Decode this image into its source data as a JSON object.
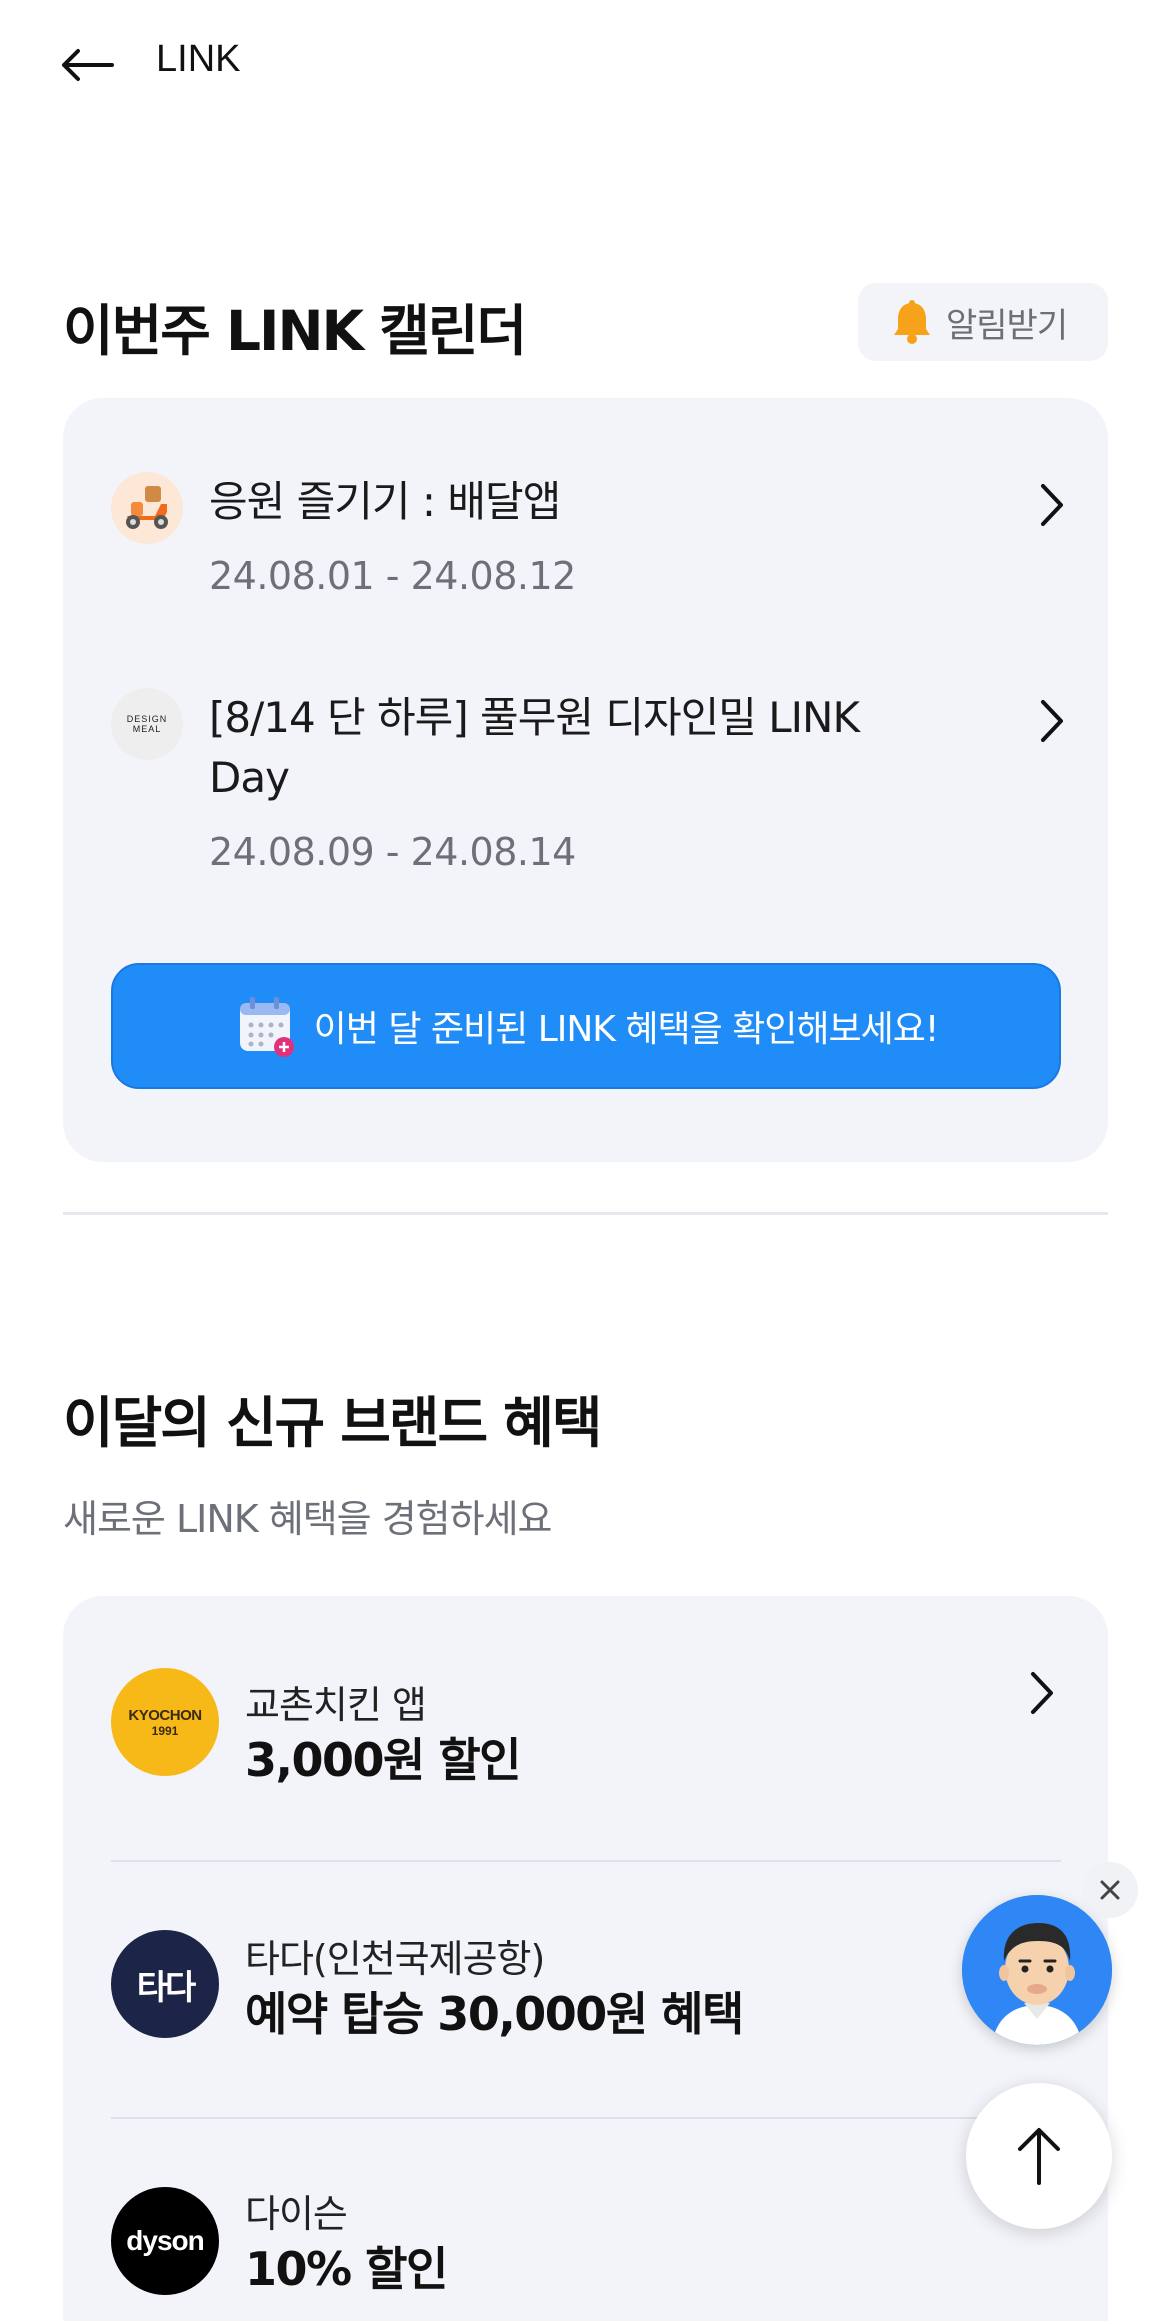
{
  "header": {
    "title": "LINK"
  },
  "calendar": {
    "title": "이번주 LINK 캘린더",
    "notify_label": "알림받기",
    "items": [
      {
        "title": "응원 즐기기 : 배달앱",
        "date": "24.08.01 - 24.08.12",
        "icon": "delivery-scooter-icon"
      },
      {
        "title": "[8/14 단 하루] 풀무원 디자인밀 LINK Day",
        "date": "24.08.09 - 24.08.14",
        "icon": "design-meal-logo",
        "logo_text": [
          "DESIGN",
          "MEAL"
        ]
      }
    ],
    "cta_label": "이번 달 준비된 LINK 혜택을 확인해보세요!"
  },
  "brands": {
    "title": "이달의 신규 브랜드 혜택",
    "subtitle": "새로운 LINK 혜택을 경험하세요",
    "items": [
      {
        "name": "교촌치킨 앱",
        "benefit": "3,000원 할인",
        "logo_text": [
          "KYOCHON",
          "1991"
        ],
        "color": "#f7b918"
      },
      {
        "name": "타다(인천국제공항)",
        "benefit": "예약 탑승 30,000원 혜택",
        "logo_text": "타다",
        "color": "#1c2447"
      },
      {
        "name": "다이슨",
        "benefit": "10% 할인",
        "logo_text": "dyson",
        "color": "#000000"
      }
    ]
  },
  "colors": {
    "accent": "#1f8cf7",
    "card_bg": "#f3f4f9",
    "bell": "#f7a21b"
  }
}
